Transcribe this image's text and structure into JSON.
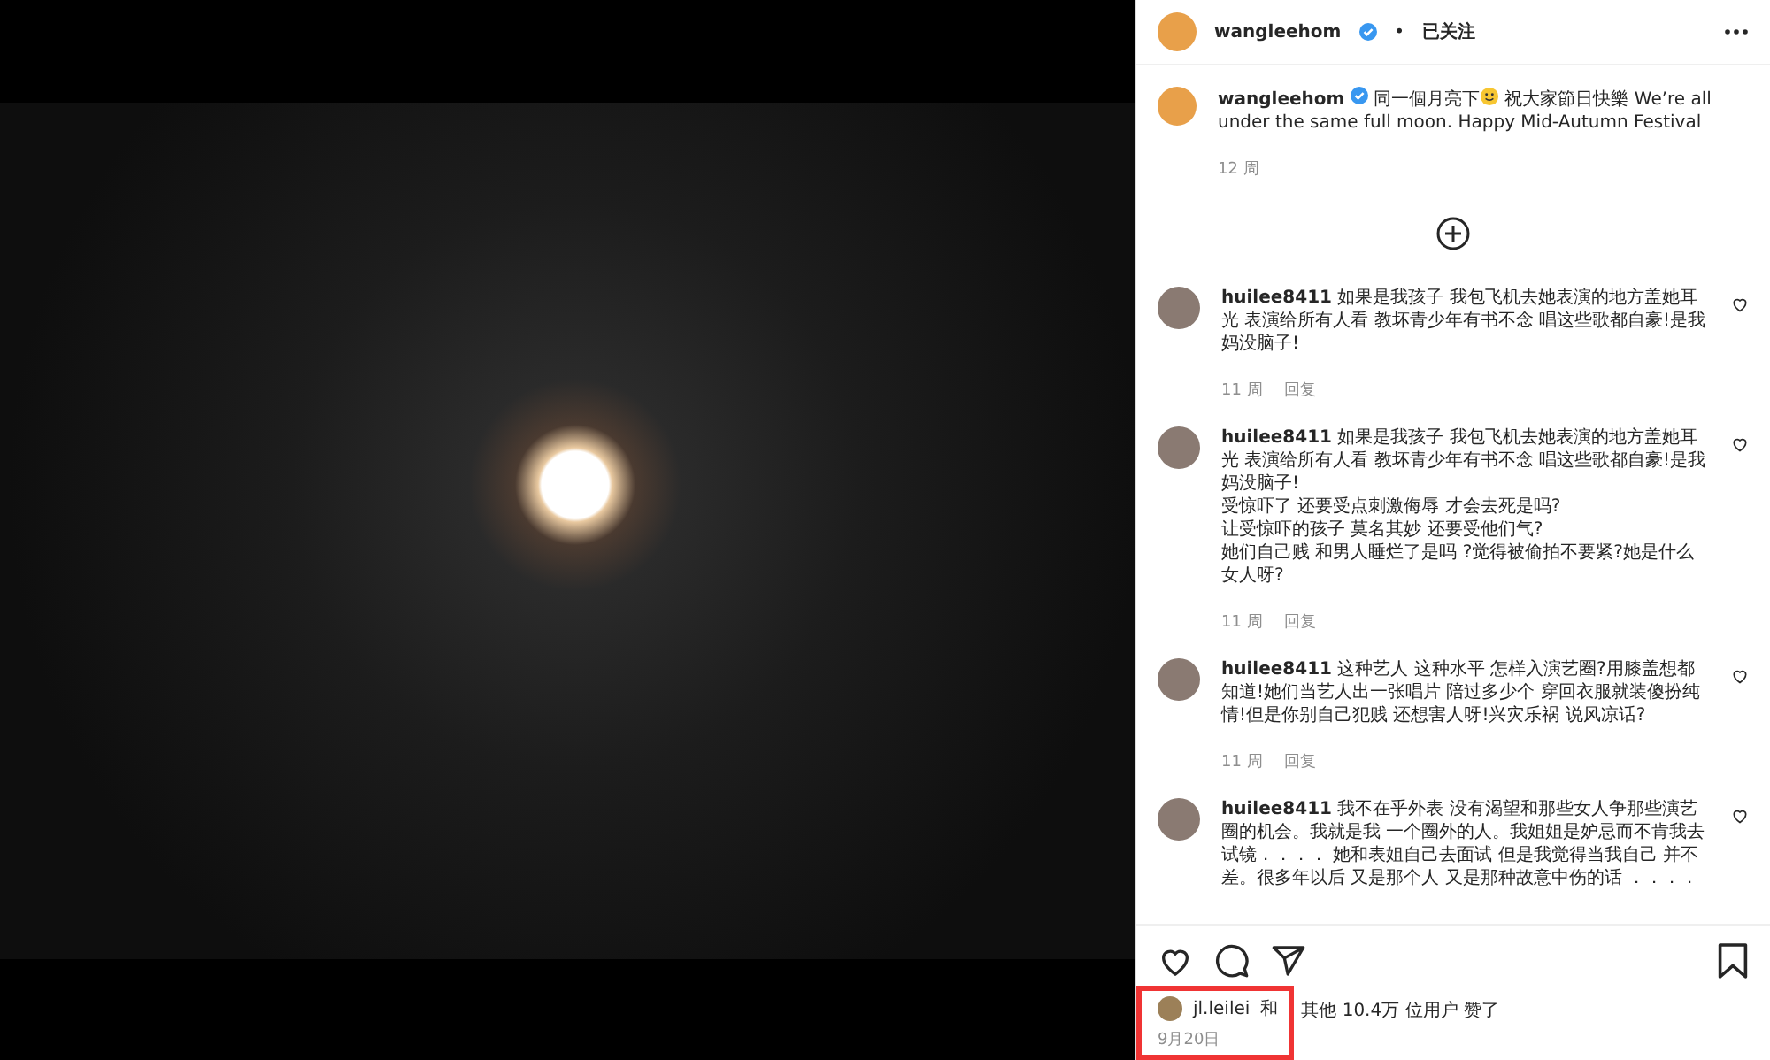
{
  "post": {
    "username": "wangleehom",
    "verified": true,
    "separator": "•",
    "follow_status": "已关注"
  },
  "caption": {
    "username": "wangleehom",
    "verified": true,
    "text_before": "同一個月亮下",
    "text_after": " 祝大家節日快樂 We’re all under the same full moon. Happy Mid-Autumn Festival",
    "time": "12 周"
  },
  "comments": [
    {
      "username": "huilee8411",
      "text": "如果是我孩子 我包飞机去她表演的地方盖她耳光 表演给所有人看 教坏青少年有书不念 唱这些歌都自豪!是我妈没脑子!",
      "time": "11 周",
      "reply": "回复",
      "liked": false
    },
    {
      "username": "huilee8411",
      "text": "如果是我孩子 我包飞机去她表演的地方盖她耳光 表演给所有人看 教坏青少年有书不念 唱这些歌都自豪!是我妈没脑子!\n受惊吓了 还要受点刺激侮辱 才会去死是吗?\n让受惊吓的孩子 莫名其妙 还要受他们气?\n她们自己贱 和男人睡烂了是吗 ?觉得被偷拍不要紧?她是什么女人呀?",
      "time": "11 周",
      "reply": "回复",
      "liked": false
    },
    {
      "username": "huilee8411",
      "text": "这种艺人 这种水平 怎样入演艺圈?用膝盖想都知道!她们当艺人出一张唱片 陪过多少个 穿回衣服就装傻扮纯情!但是你别自己犯贱 还想害人呀!兴灾乐祸 说风凉话?",
      "time": "11 周",
      "reply": "回复",
      "liked": false
    },
    {
      "username": "huilee8411",
      "text": "我不在乎外表 没有渴望和那些女人争那些演艺圈的机会。我就是我 一个圈外的人。我姐姐是妒忌而不肯我去试镜．．．． 她和表姐自己去面试 但是我觉得当我自己 并不差。很多年以后 又是那个人 又是那种故意中伤的话 ．．．．",
      "liked": false
    }
  ],
  "actions": {
    "liked": false,
    "saved": false
  },
  "likes": {
    "username": "jl.leilei",
    "conjunction": "和",
    "text": "其他 10.4万 位用户 赞了",
    "date": "9月20日"
  }
}
